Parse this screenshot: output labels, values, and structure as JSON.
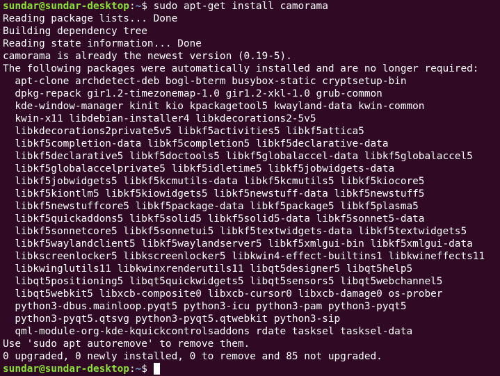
{
  "colors": {
    "background": "#300a24",
    "text": "#ffffff",
    "prompt_user": "#8ae234",
    "prompt_path": "#729fcf"
  },
  "prompt1": {
    "user": "sundar@sundar-desktop",
    "sep": ":",
    "path": "~",
    "symbol": "$ ",
    "command": "sudo apt-get install camorama"
  },
  "output": [
    "Reading package lists... Done",
    "Building dependency tree",
    "Reading state information... Done",
    "camorama is already the newest version (0.19-5).",
    "The following packages were automatically installed and are no longer required:",
    "  apt-clone archdetect-deb bogl-bterm busybox-static cryptsetup-bin",
    "  dpkg-repack gir1.2-timezonemap-1.0 gir1.2-xkl-1.0 grub-common",
    "  kde-window-manager kinit kio kpackagetool5 kwayland-data kwin-common",
    "  kwin-x11 libdebian-installer4 libkdecorations2-5v5",
    "  libkdecorations2private5v5 libkf5activities5 libkf5attica5",
    "  libkf5completion-data libkf5completion5 libkf5declarative-data",
    "  libkf5declarative5 libkf5doctools5 libkf5globalaccel-data libkf5globalaccel5",
    "  libkf5globalaccelprivate5 libkf5idletime5 libkf5jobwidgets-data",
    "  libkf5jobwidgets5 libkf5kcmutils-data libkf5kcmutils5 libkf5kiocore5",
    "  libkf5kiontlm5 libkf5kiowidgets5 libkf5newstuff-data libkf5newstuff5",
    "  libkf5newstuffcore5 libkf5package-data libkf5package5 libkf5plasma5",
    "  libkf5quickaddons5 libkf5solid5 libkf5solid5-data libkf5sonnet5-data",
    "  libkf5sonnetcore5 libkf5sonnetui5 libkf5textwidgets-data libkf5textwidgets5",
    "  libkf5waylandclient5 libkf5waylandserver5 libkf5xmlgui-bin libkf5xmlgui-data",
    "  libkscreenlocker5 libkscreenlocker5 libkwin4-effect-builtins1 libkwineffects11",
    "  libkwinglutils11 libkwinxrenderutils11 libqt5designer5 libqt5help5",
    "  libqt5positioning5 libqt5quickwidgets5 libqt5sensors5 libqt5webchannel5",
    "  libqt5webkit5 libxcb-composite0 libxcb-cursor0 libxcb-damage0 os-prober",
    "  python3-dbus.mainloop.pyqt5 python3-icu python3-pam python3-pyqt5",
    "  python3-pyqt5.qtsvg python3-pyqt5.qtwebkit python3-sip",
    "  qml-module-org-kde-kquickcontrolsaddons rdate tasksel tasksel-data",
    "Use 'sudo apt autoremove' to remove them.",
    "0 upgraded, 0 newly installed, 0 to remove and 85 not upgraded."
  ],
  "prompt2": {
    "user": "sundar@sundar-desktop",
    "sep": ":",
    "path": "~",
    "symbol": "$ "
  }
}
